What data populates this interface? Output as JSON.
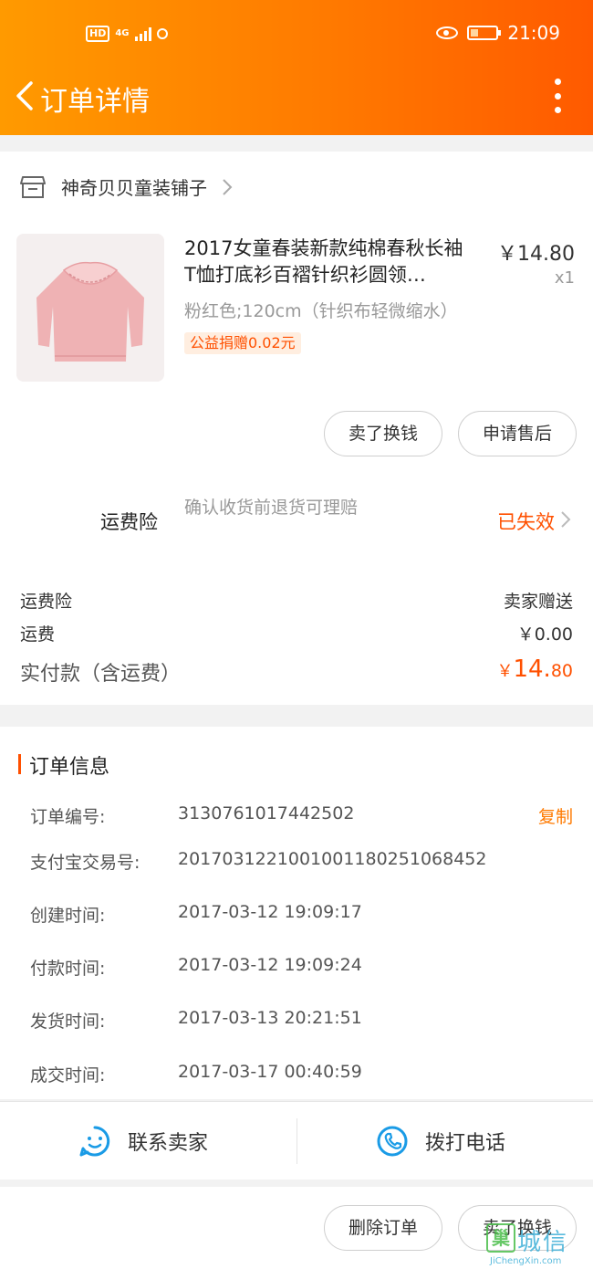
{
  "status_bar": {
    "hd": "HD",
    "network": "4G",
    "time": "21:09"
  },
  "nav": {
    "title": "订单详情"
  },
  "shop": {
    "name": "神奇贝贝童装铺子"
  },
  "product": {
    "title": "2017女童春装新款纯棉春秋长袖T恤打底衫百褶针织衫圆领…",
    "price": "￥14.80",
    "quantity": "x1",
    "sku": "粉红色;120cm（针织布轻微缩水）",
    "donation": "公益捐赠0.02元"
  },
  "actions": {
    "sell_exchange": "卖了换钱",
    "after_sale": "申请售后"
  },
  "insurance": {
    "label": "运费险",
    "description": "确认收货前退货可理赔",
    "status": "已失效"
  },
  "summary": {
    "insurance_label": "运费险",
    "insurance_value": "卖家赠送",
    "shipping_label": "运费",
    "shipping_value": "￥0.00",
    "paid_label": "实付款（含运费）",
    "paid_currency": "￥",
    "paid_integer": "14.",
    "paid_decimal": "80"
  },
  "order_info": {
    "title": "订单信息",
    "copy_label": "复制",
    "rows": [
      {
        "key": "订单编号:",
        "value": "3130761017442502"
      },
      {
        "key": "支付宝交易号:",
        "value": "2017031221001001180251068452"
      },
      {
        "key": "创建时间:",
        "value": "2017-03-12 19:09:17"
      },
      {
        "key": "付款时间:",
        "value": "2017-03-12 19:09:24"
      },
      {
        "key": "发货时间:",
        "value": "2017-03-13 20:21:51"
      },
      {
        "key": "成交时间:",
        "value": "2017-03-17 00:40:59"
      }
    ]
  },
  "contact": {
    "seller": "联系卖家",
    "call": "拨打电话"
  },
  "bottom": {
    "delete": "删除订单",
    "sell_exchange": "卖了换钱"
  },
  "watermark": {
    "logo": "巢",
    "name": "城信",
    "url": "JiChengXin.com"
  },
  "colors": {
    "accent": "#ff5000",
    "header_start": "#ff9a00",
    "header_end": "#ff5a00",
    "icon_blue": "#1a9be6"
  }
}
